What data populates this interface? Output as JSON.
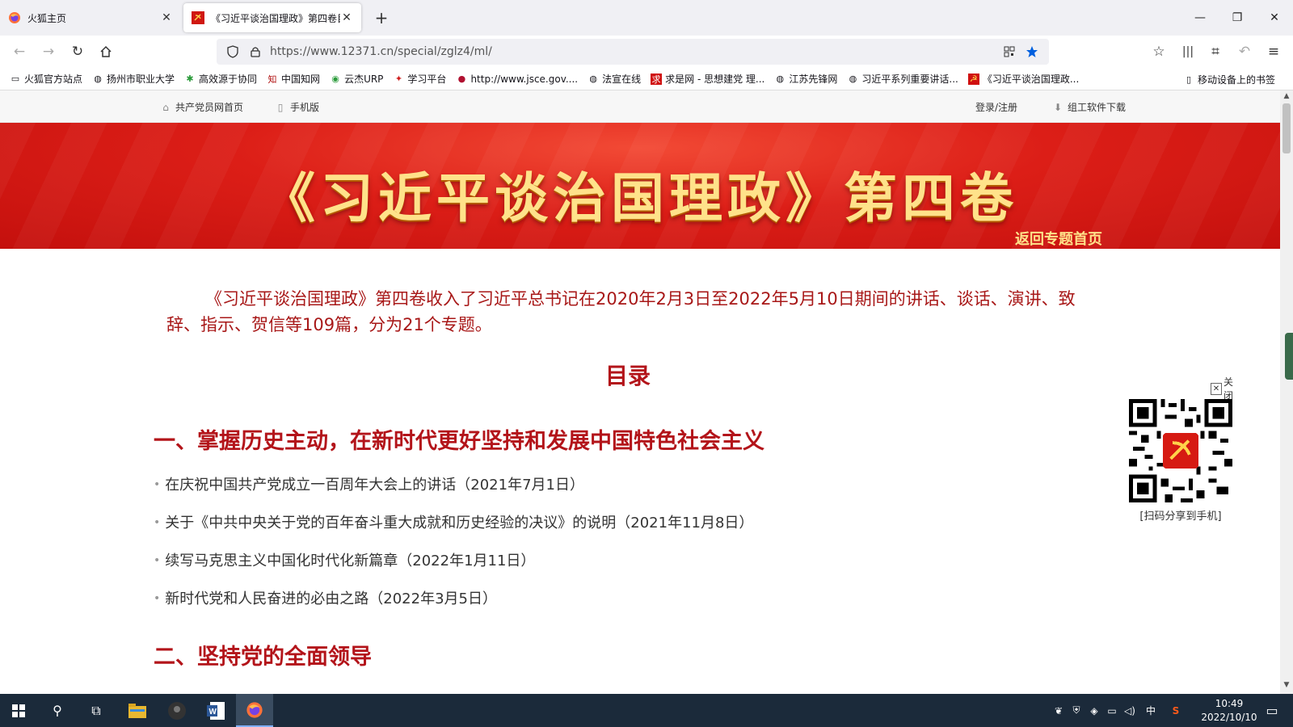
{
  "browser": {
    "tabs": [
      {
        "title": "火狐主页",
        "active": false
      },
      {
        "title": "《习近平谈治国理政》第四卷目",
        "active": true
      }
    ],
    "url": "https://www.12371.cn/special/zglz4/ml/",
    "bookmarks": [
      {
        "label": "火狐官方站点",
        "icon": "folder-icon"
      },
      {
        "label": "扬州市职业大学",
        "icon": "globe-icon"
      },
      {
        "label": "高效源于协同",
        "icon": "gear-icon"
      },
      {
        "label": "中国知网",
        "icon": "cnki-icon"
      },
      {
        "label": "云杰URP",
        "icon": "chrome-like-icon"
      },
      {
        "label": "学习平台",
        "icon": "xuexi-icon"
      },
      {
        "label": "http://www.jsce.gov....",
        "icon": "red-circle-icon"
      },
      {
        "label": "法宣在线",
        "icon": "globe-icon"
      },
      {
        "label": "求是网 - 思想建党 理...",
        "icon": "qiushi-icon"
      },
      {
        "label": "江苏先锋网",
        "icon": "globe-icon"
      },
      {
        "label": "习近平系列重要讲话...",
        "icon": "globe-icon"
      },
      {
        "label": "《习近平谈治国理政...",
        "icon": "party-icon"
      }
    ],
    "mobile_bookmarks": "移动设备上的书签"
  },
  "page": {
    "topbar": {
      "home_link": "共产党员网首页",
      "mobile_link": "手机版",
      "login": "登录/注册",
      "download": "组工软件下载"
    },
    "banner": {
      "title": "《习近平谈治国理政》第四卷",
      "back_link": "返回专题首页"
    },
    "intro": "《习近平谈治国理政》第四卷收入了习近平总书记在2020年2月3日至2022年5月10日期间的讲话、谈话、演讲、致辞、指示、贺信等109篇，分为21个专题。",
    "toc_title": "目录",
    "sections": [
      {
        "title": "一、掌握历史主动，在新时代更好坚持和发展中国特色社会主义",
        "items": [
          "在庆祝中国共产党成立一百周年大会上的讲话（2021年7月1日）",
          "关于《中共中央关于党的百年奋斗重大成就和历史经验的决议》的说明（2021年11月8日）",
          "续写马克思主义中国化时代化新篇章（2022年1月11日）",
          "新时代党和人民奋进的必由之路（2022年3月5日）"
        ]
      },
      {
        "title": "二、坚持党的全面领导",
        "items": []
      }
    ],
    "qr": {
      "close_label": "关闭",
      "caption": "[扫码分享到手机]"
    }
  },
  "taskbar": {
    "time": "10:49",
    "date": "2022/10/10",
    "ime": "中"
  },
  "colors": {
    "banner_red": "#dc1e17",
    "heading_red": "#b3141a",
    "intro_red": "#a81818",
    "banner_gold": "#ffe28a"
  }
}
